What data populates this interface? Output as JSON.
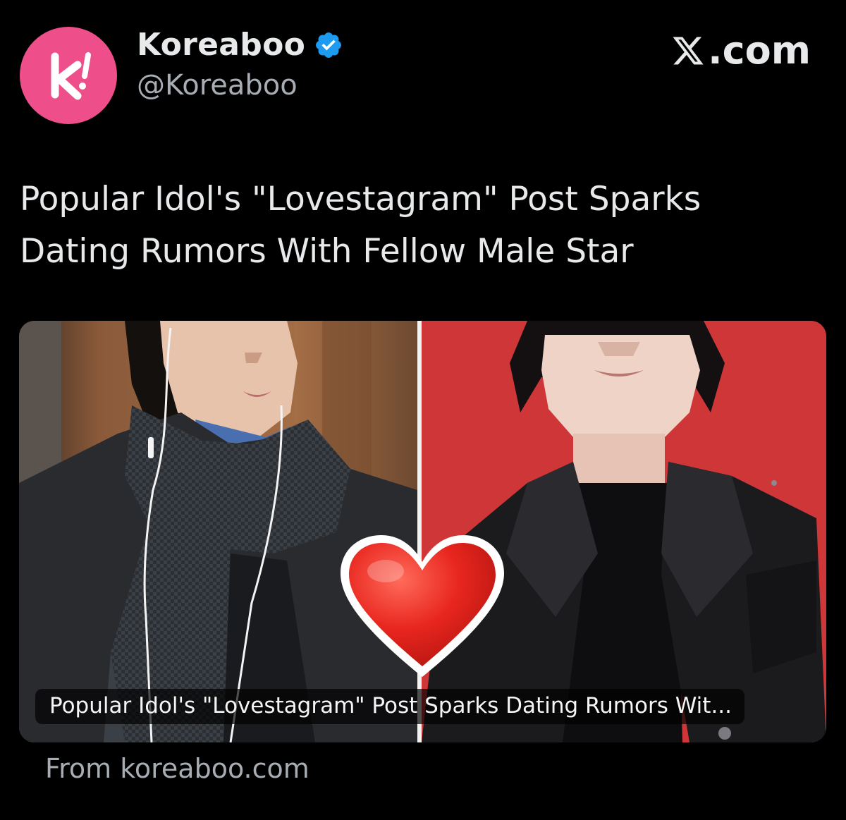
{
  "account": {
    "display_name": "Koreaboo",
    "handle": "@Koreaboo",
    "verified": true,
    "avatar_letter": "k!",
    "avatar_color": "#ee4f8a",
    "verified_color": "#1d9bf0"
  },
  "site_badge": {
    "label": ".com",
    "icon": "x-logo-icon"
  },
  "post": {
    "headline": "Popular Idol's \"Lovestagram\" Post Sparks Dating Rumors With Fellow Male Star"
  },
  "link_card": {
    "caption": "Popular Idol's \"Lovestagram\" Post Sparks Dating Rumors Wit...",
    "left_image": "man-in-scarf-with-earphones-photo",
    "right_image": "man-in-leather-jacket-photo",
    "overlay_icon": "red-heart-icon",
    "source": "From koreaboo.com"
  }
}
